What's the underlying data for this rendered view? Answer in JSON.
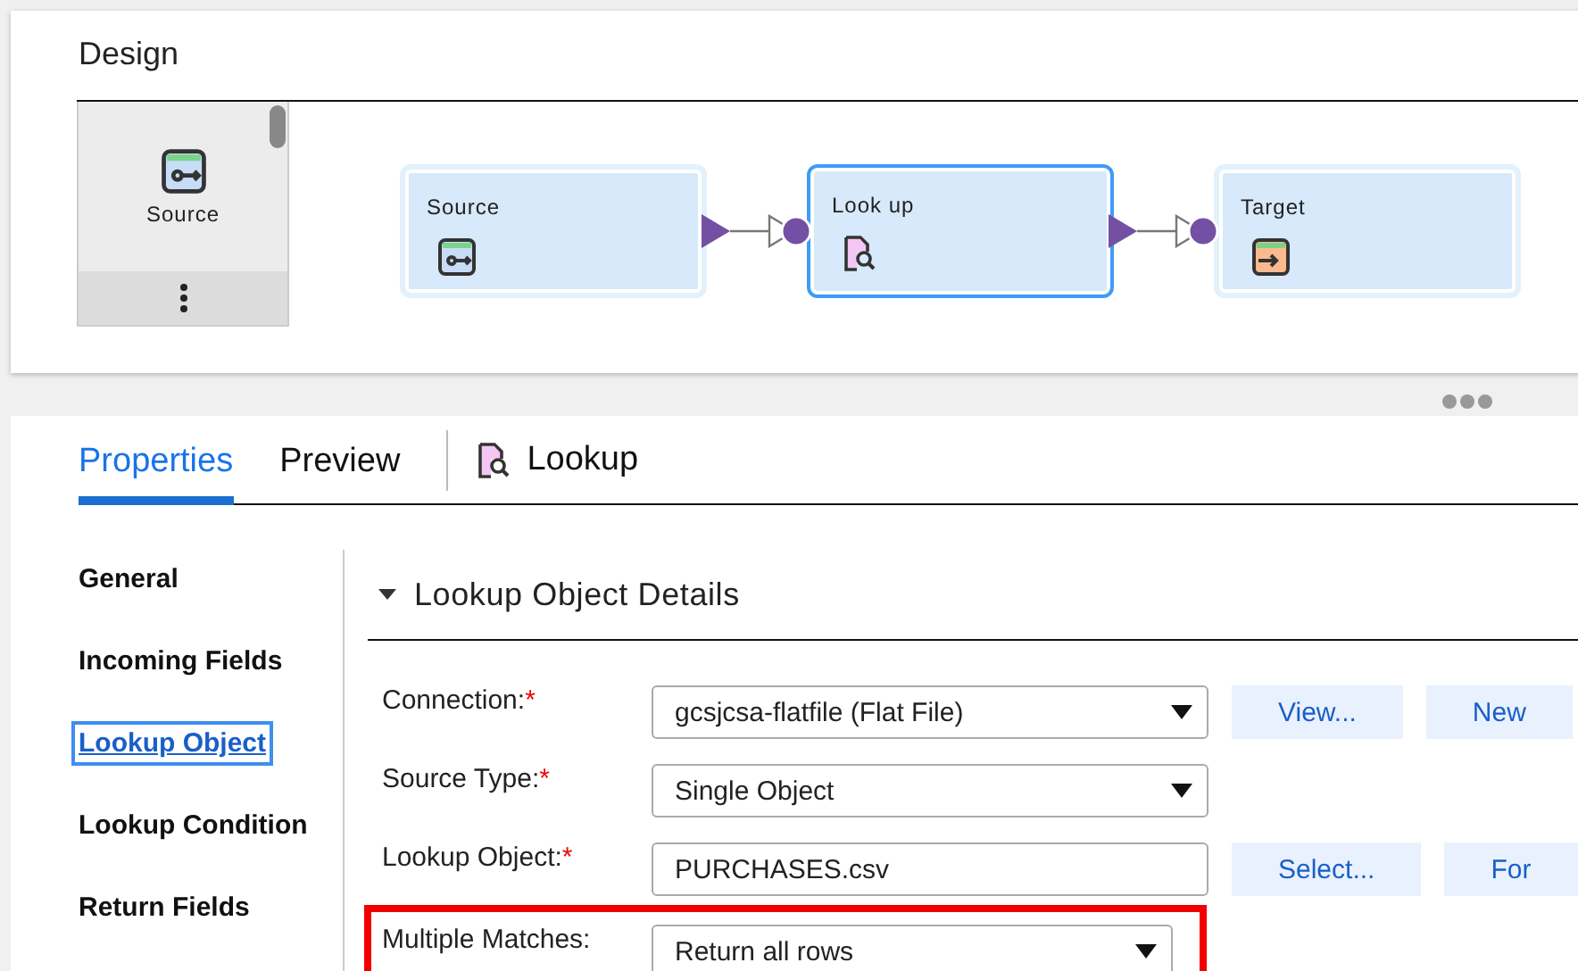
{
  "design": {
    "title": "Design",
    "palette": {
      "items": [
        {
          "label": "Source"
        }
      ]
    },
    "nodes": [
      {
        "label": "Source",
        "kind": "source",
        "selected": false
      },
      {
        "label": "Look up",
        "kind": "lookup",
        "selected": true
      },
      {
        "label": "Target",
        "kind": "target",
        "selected": false
      }
    ]
  },
  "properties": {
    "tabs": [
      {
        "label": "Properties",
        "selected": true
      },
      {
        "label": "Preview",
        "selected": false
      }
    ],
    "object_title": "Lookup",
    "sidebar": [
      {
        "label": "General",
        "selected": false
      },
      {
        "label": "Incoming Fields",
        "selected": false
      },
      {
        "label": "Lookup Object",
        "selected": true
      },
      {
        "label": "Lookup Condition",
        "selected": false
      },
      {
        "label": "Return Fields",
        "selected": false
      }
    ],
    "section": {
      "title": "Lookup Object Details",
      "expanded": true
    },
    "fields": [
      {
        "label": "Connection:",
        "required_mark": "*",
        "kind": "select",
        "value": "gcsjcsa-flatfile (Flat File)",
        "buttons": [
          "View...",
          "New"
        ],
        "highlighted": false
      },
      {
        "label": "Source Type:",
        "required_mark": "*",
        "kind": "select",
        "value": "Single Object",
        "highlighted": false
      },
      {
        "label": "Lookup Object:",
        "required_mark": "*",
        "kind": "text",
        "value": "PURCHASES.csv",
        "buttons": [
          "Select...",
          "For"
        ],
        "highlighted": false
      },
      {
        "label": "Multiple Matches:",
        "kind": "select",
        "value": "Return all rows",
        "highlighted": true
      }
    ]
  }
}
